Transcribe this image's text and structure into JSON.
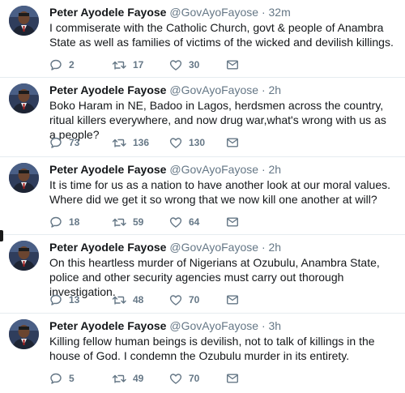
{
  "tweets": [
    {
      "name": "Peter Ayodele Fayose",
      "handle": "@GovAyoFayose",
      "separator": "·",
      "time": "32m",
      "text": "I commiserate with the Catholic Church, govt & people of Anambra State as well as families of victims of the wicked and devilish killings.",
      "replies": "2",
      "retweets": "17",
      "likes": "30"
    },
    {
      "name": "Peter Ayodele Fayose",
      "handle": "@GovAyoFayose",
      "separator": "·",
      "time": "2h",
      "text": "Boko Haram in NE, Badoo in Lagos, herdsmen across the country, ritual killers everywhere, and now drug war,what's wrong with us as a people?",
      "replies": "73",
      "retweets": "136",
      "likes": "130"
    },
    {
      "name": "Peter Ayodele Fayose",
      "handle": "@GovAyoFayose",
      "separator": "·",
      "time": "2h",
      "text": "It is time for us as a nation to have another look at our moral values. Where did we get it so wrong that we now kill one another at will?",
      "replies": "18",
      "retweets": "59",
      "likes": "64"
    },
    {
      "name": "Peter Ayodele Fayose",
      "handle": "@GovAyoFayose",
      "separator": "·",
      "time": "2h",
      "text": "On this heartless murder of Nigerians at Ozubulu, Anambra State, police and other security agencies must carry out thorough investigation.",
      "replies": "13",
      "retweets": "48",
      "likes": "70"
    },
    {
      "name": "Peter Ayodele Fayose",
      "handle": "@GovAyoFayose",
      "separator": "·",
      "time": "3h",
      "text": "Killing fellow human beings is devilish, not to talk of killings in the house of God. I condemn the Ozubulu murder in its entirety.",
      "replies": "5",
      "retweets": "49",
      "likes": "70"
    }
  ],
  "icons": {
    "reply": "reply-icon",
    "retweet": "retweet-icon",
    "like": "heart-icon",
    "dm": "envelope-icon"
  },
  "colors": {
    "icon_gray": "#657786",
    "text": "#14171a",
    "divider": "#e6ecf0"
  }
}
